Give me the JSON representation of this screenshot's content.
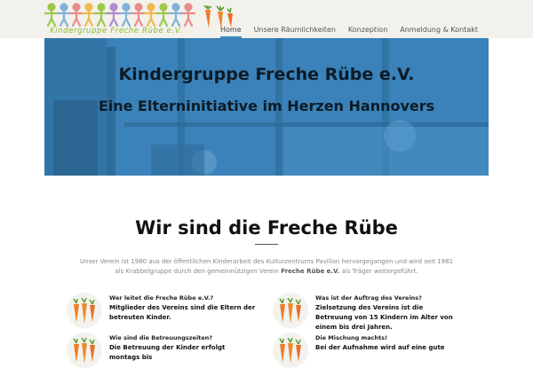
{
  "header": {
    "logo_text": "Kindergruppe Freche Rübe e.V.",
    "nav": [
      {
        "label": "Home",
        "active": true
      },
      {
        "label": "Unsere Räumlichkeiten",
        "active": false
      },
      {
        "label": "Konzeption",
        "active": false
      },
      {
        "label": "Anmeldung & Kontakt",
        "active": false
      }
    ],
    "accent_color": "#3b8ec4",
    "logo_color": "#8cbb2b"
  },
  "hero": {
    "title": "Kindergruppe Freche Rübe e.V.",
    "subtitle": "Eine Elterninitiative im Herzen Hannovers"
  },
  "intro": {
    "title": "Wir sind die Freche Rübe",
    "text_before": "Unser Verein ist 1980 aus der öffentlichen Kinderarbeit des Kulturzentrums Pavillon hervorgegangen und wird seit 1981 als Krabbelgruppe durch den gemeinnützigen Verein ",
    "text_bold": "Freche Rübe e.V.",
    "text_after": " als Träger weitergeführt."
  },
  "features": [
    {
      "question": "Wer leitet die Freche Rübe e.V.?",
      "answer": "Mitglieder des Vereins sind die Eltern der betreuten Kinder.",
      "icon": "carrots-icon"
    },
    {
      "question": "Was ist der Auftrag des Vereins?",
      "answer": "Zielsetzung des Vereins ist die Betreuung von 15 Kindern im Alter von einem bis drei Jahren.",
      "icon": "carrots-icon"
    },
    {
      "question": "Wie sind die Betreuungszeiten?",
      "answer": "Die Betreuung der Kinder erfolgt montags bis",
      "icon": "carrots-icon"
    },
    {
      "question": "Die Mischung machts!",
      "answer": "Bei der Aufnahme wird auf eine gute",
      "icon": "carrots-icon"
    }
  ]
}
